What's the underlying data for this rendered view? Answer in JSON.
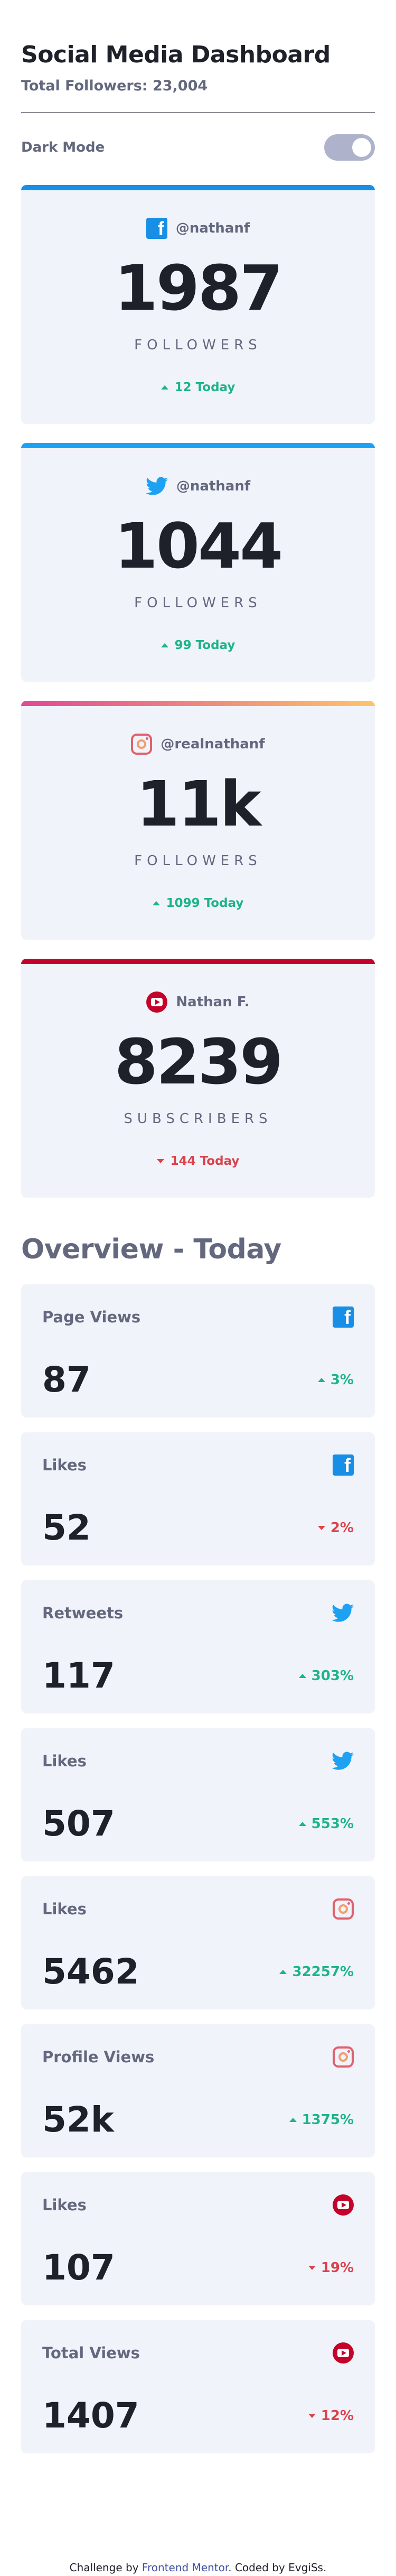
{
  "header": {
    "title": "Social Media Dashboard",
    "total_followers": "Total Followers: 23,004",
    "dark_mode_label": "Dark Mode"
  },
  "colors": {
    "facebook": "#178fe6",
    "twitter": "#1da1f2",
    "instagram_gradient": [
      "#df4996",
      "#fdc468"
    ],
    "youtube": "#c4032a",
    "up": "#1db489",
    "down": "#dc414c"
  },
  "follower_cards": [
    {
      "network": "facebook",
      "icon": "facebook-icon",
      "handle": "@nathanf",
      "count": "1987",
      "unit": "FOLLOWERS",
      "today": "12 Today",
      "trend": "up"
    },
    {
      "network": "twitter",
      "icon": "twitter-icon",
      "handle": "@nathanf",
      "count": "1044",
      "unit": "FOLLOWERS",
      "today": "99 Today",
      "trend": "up"
    },
    {
      "network": "instagram",
      "icon": "instagram-icon",
      "handle": "@realnathanf",
      "count": "11k",
      "unit": "FOLLOWERS",
      "today": "1099 Today",
      "trend": "up"
    },
    {
      "network": "youtube",
      "icon": "youtube-icon",
      "handle": "Nathan F.",
      "count": "8239",
      "unit": "SUBSCRIBERS",
      "today": "144 Today",
      "trend": "down"
    }
  ],
  "overview": {
    "title": "Overview - Today",
    "items": [
      {
        "label": "Page Views",
        "icon": "facebook-icon",
        "value": "87",
        "percent": "3%",
        "trend": "up"
      },
      {
        "label": "Likes",
        "icon": "facebook-icon",
        "value": "52",
        "percent": "2%",
        "trend": "down"
      },
      {
        "label": "Retweets",
        "icon": "twitter-icon",
        "value": "117",
        "percent": "303%",
        "trend": "up"
      },
      {
        "label": "Likes",
        "icon": "twitter-icon",
        "value": "507",
        "percent": "553%",
        "trend": "up"
      },
      {
        "label": "Likes",
        "icon": "instagram-icon",
        "value": "5462",
        "percent": "32257%",
        "trend": "up"
      },
      {
        "label": "Profile Views",
        "icon": "instagram-icon",
        "value": "52k",
        "percent": "1375%",
        "trend": "up"
      },
      {
        "label": "Likes",
        "icon": "youtube-icon",
        "value": "107",
        "percent": "19%",
        "trend": "down"
      },
      {
        "label": "Total Views",
        "icon": "youtube-icon",
        "value": "1407",
        "percent": "12%",
        "trend": "down"
      }
    ]
  },
  "footer": {
    "prefix": "Challenge by ",
    "link": "Frontend Mentor",
    "suffix": ". Coded by EvgiSs."
  }
}
